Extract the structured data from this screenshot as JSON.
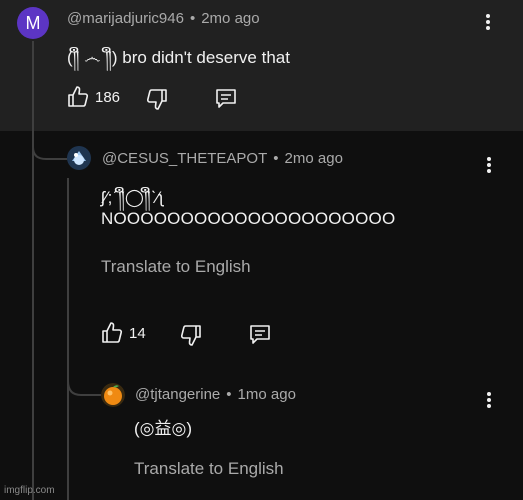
{
  "comment1": {
    "avatar_letter": "M",
    "author": "@marijadjuric946",
    "separator": "•",
    "time": "2mo ago",
    "text": "(༎ຶ ෴ ༎ຶ) bro didn't deserve that",
    "likes": "186"
  },
  "reply1": {
    "author": "@CESUS_THETEAPOT",
    "separator": "•",
    "time": "2mo ago",
    "text_line1": "ʃ⁄;ˊ༎ຶ◯༎ຶˋ⁄ʅ",
    "text_line2": "NOOOOOOOOOOOOOOOOOOOOO",
    "translate": "Translate to English",
    "likes": "14"
  },
  "reply2": {
    "author": "@tjtangerine",
    "separator": "•",
    "time": "1mo ago",
    "text": "(◎益◎)",
    "translate": "Translate to English"
  },
  "watermark": "imgflip.com",
  "colors": {
    "background": "#0f0f0f",
    "highlight": "#212121",
    "avatar_m": "#5c35c4",
    "meta_text": "#aaaaaa",
    "thread_line": "#3f3f3f"
  },
  "icons": [
    "like-icon",
    "dislike-icon",
    "reply-icon",
    "kebab-menu-icon"
  ]
}
